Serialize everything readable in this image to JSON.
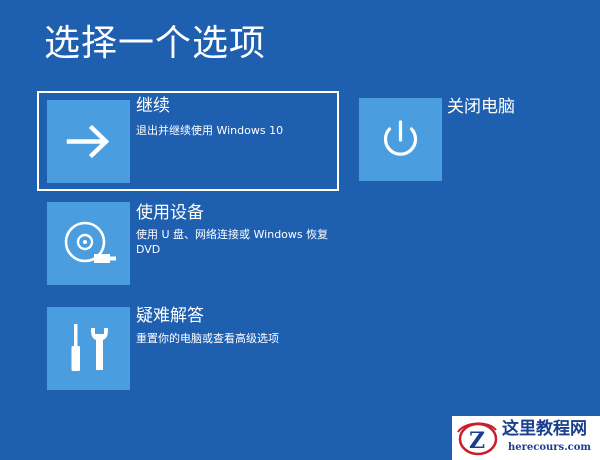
{
  "page": {
    "title": "选择一个选项"
  },
  "options": {
    "continue": {
      "title": "继续",
      "description": "退出并继续使用 Windows 10",
      "icon": "arrow-right-icon",
      "selected": true
    },
    "shutdown": {
      "title": "关闭电脑",
      "icon": "power-icon"
    },
    "device": {
      "title": "使用设备",
      "description": "使用 U 盘、网络连接或 Windows 恢复 DVD",
      "icon": "disc-usb-icon"
    },
    "troubleshoot": {
      "title": "疑难解答",
      "description": "重置你的电脑或查看高级选项",
      "icon": "tools-icon"
    }
  },
  "watermark": {
    "name": "这里教程网",
    "url": "herecours.com"
  },
  "colors": {
    "background": "#1e5fb0",
    "tile": "#4a9ee0",
    "text": "#ffffff",
    "watermark_text": "#1a3f8f"
  }
}
